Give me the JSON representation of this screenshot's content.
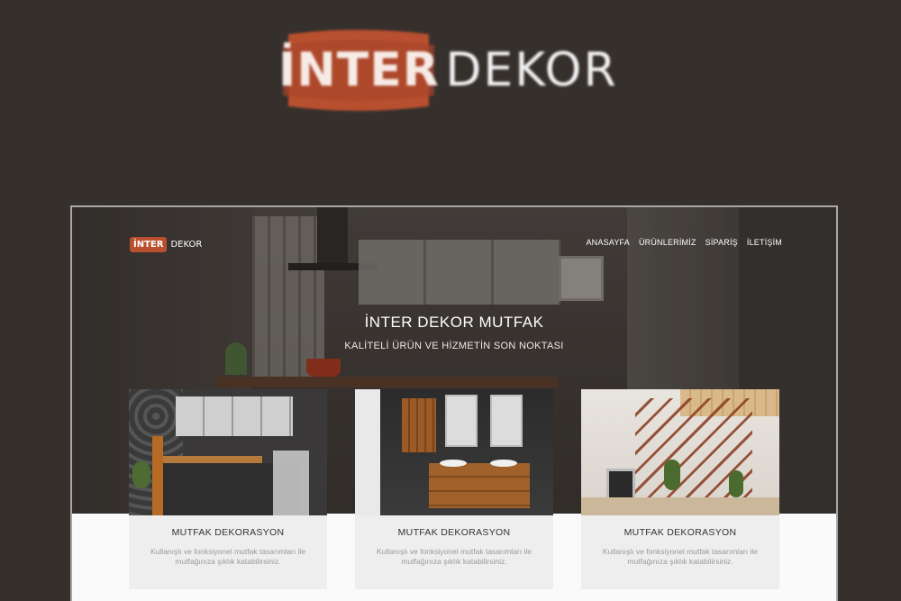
{
  "banner": {
    "logo_part1": "İNTER",
    "logo_part2": "DEKOR"
  },
  "site": {
    "logo_part1": "İNTER",
    "logo_part2": "DEKOR",
    "menu": [
      "ANASAYFA",
      "ÜRÜNLERİMİZ",
      "SİPARİŞ",
      "İLETİŞİM"
    ],
    "hero_title": "İNTER DEKOR MUTFAK",
    "hero_subtitle": "KALİTELİ ÜRÜN VE HİZMETİN SON NOKTASI",
    "cards": [
      {
        "title": "MUTFAK DEKORASYON",
        "desc": "Kullanışlı ve fonksiyonel mutfak tasarımları ile mutfağınıza şıklık katabilirsiniz."
      },
      {
        "title": "MUTFAK DEKORASYON",
        "desc": "Kullanışlı ve fonksiyonel mutfak tasarımları ile mutfağınıza şıklık katabilirsiniz."
      },
      {
        "title": "MUTFAK DEKORASYON",
        "desc": "Kullanışlı ve fonksiyonel mutfak tasarımları ile mutfağınıza şıklık katabilirsiniz."
      }
    ]
  },
  "colors": {
    "background": "#36302d",
    "brand": "#b8502f",
    "card_bg": "#eeeeee"
  }
}
